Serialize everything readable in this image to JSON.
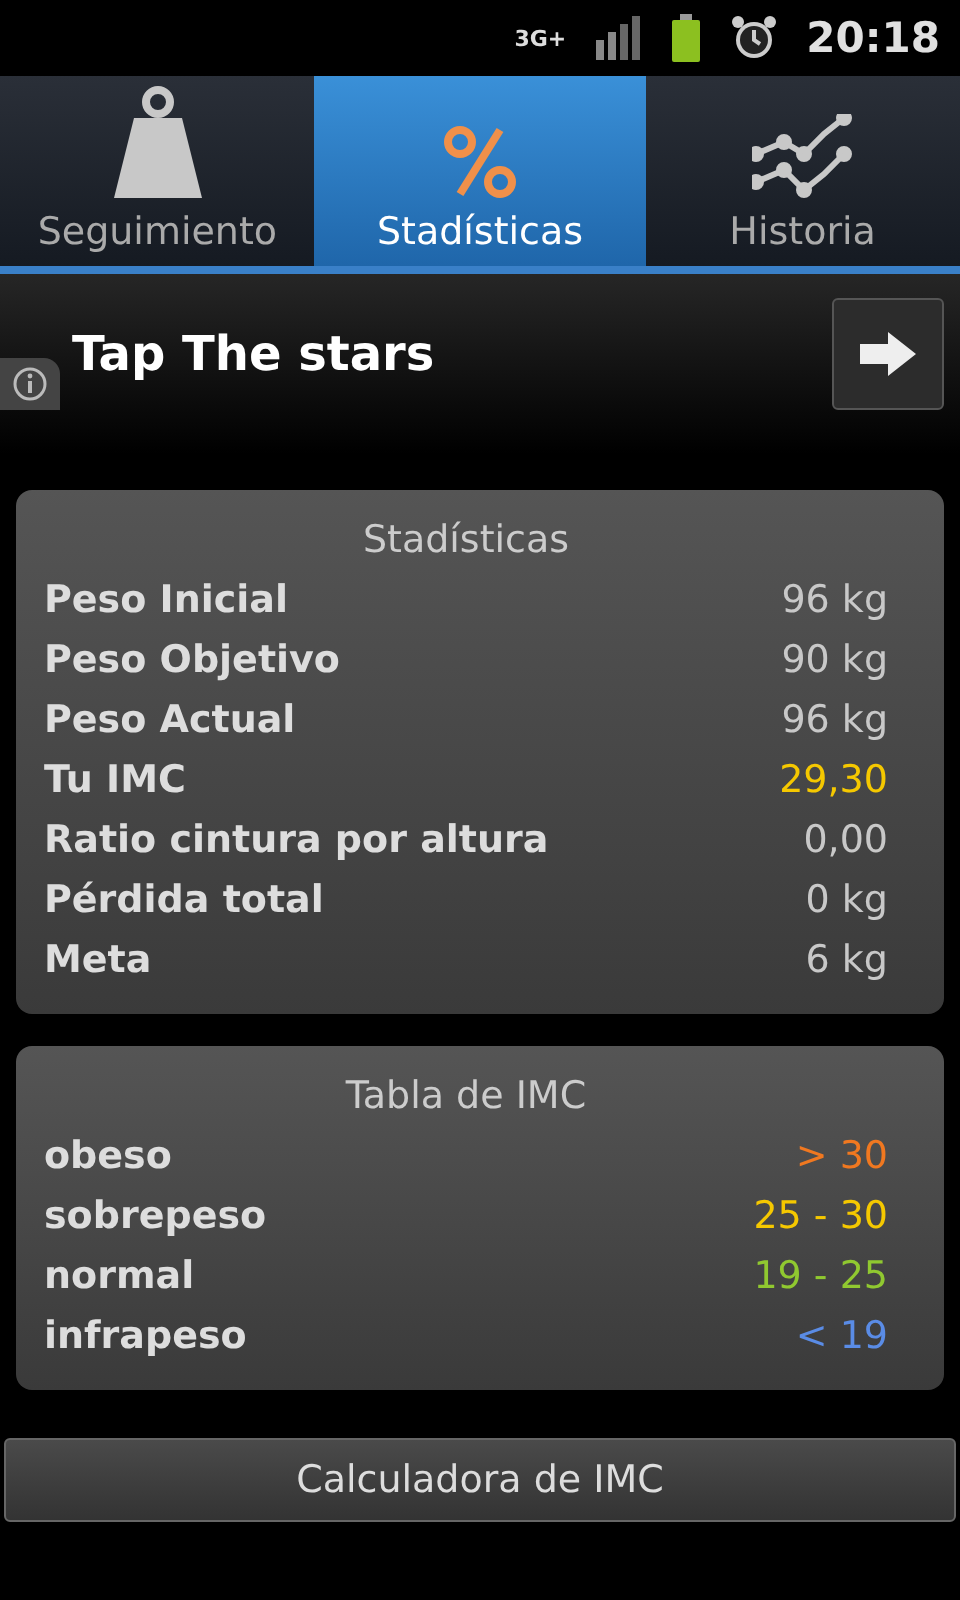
{
  "status_bar": {
    "network": "3G+",
    "time": "20:18"
  },
  "tabs": [
    {
      "label": "Seguimiento",
      "kind": "weight",
      "selected": false
    },
    {
      "label": "Stadísticas",
      "kind": "percent",
      "selected": true
    },
    {
      "label": "Historia",
      "kind": "chart",
      "selected": false
    }
  ],
  "banner": {
    "text": "Tap The stars"
  },
  "stats": {
    "title": "Stadísticas",
    "rows": [
      {
        "label": "Peso Inicial",
        "value": "96 kg",
        "color": "#c8c8c8"
      },
      {
        "label": "Peso Objetivo",
        "value": "90 kg",
        "color": "#c8c8c8"
      },
      {
        "label": "Peso Actual",
        "value": "96 kg",
        "color": "#c8c8c8"
      },
      {
        "label": "Tu IMC",
        "value": "29,30",
        "color": "#f5c800"
      },
      {
        "label": "Ratio cintura por altura",
        "value": "0,00",
        "color": "#c8c8c8"
      },
      {
        "label": "Pérdida total",
        "value": "0 kg",
        "color": "#c8c8c8"
      },
      {
        "label": "Meta",
        "value": "6 kg",
        "color": "#c8c8c8"
      }
    ]
  },
  "imc_table": {
    "title": "Tabla de IMC",
    "rows": [
      {
        "label": "obeso",
        "range": "> 30",
        "color": "#f07820"
      },
      {
        "label": "sobrepeso",
        "range": "25 - 30",
        "color": "#f5c800"
      },
      {
        "label": "normal",
        "range": "19 - 25",
        "color": "#90c830"
      },
      {
        "label": "infrapeso",
        "range": "< 19",
        "color": "#5a8ce6"
      }
    ]
  },
  "calculator_button": {
    "label": "Calculadora de IMC"
  }
}
